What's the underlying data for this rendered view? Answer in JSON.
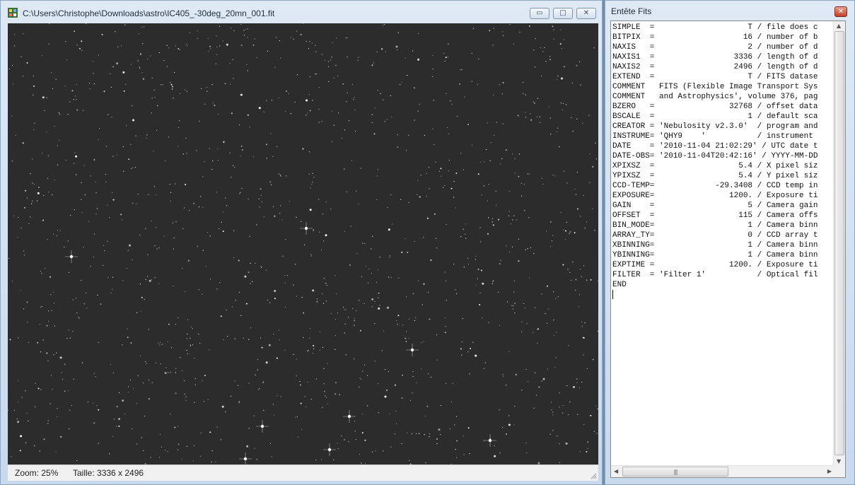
{
  "image_window": {
    "title": "C:\\Users\\Christophe\\Downloads\\astro\\IC405_-30deg_20mn_001.fit",
    "app_icon": "fits-viewer-icon",
    "buttons": {
      "minimize": "▭",
      "maximize": "□",
      "close": "✕"
    },
    "status": {
      "zoom": "Zoom: 25%",
      "size": "Taille: 3336 x 2496"
    }
  },
  "header_window": {
    "title": "Entête Fits",
    "close": "✕",
    "lines": [
      "SIMPLE  =                    T / file does c",
      "BITPIX  =                   16 / number of b",
      "NAXIS   =                    2 / number of d",
      "NAXIS1  =                 3336 / length of d",
      "NAXIS2  =                 2496 / length of d",
      "EXTEND  =                    T / FITS datase",
      "COMMENT   FITS (Flexible Image Transport Sys",
      "COMMENT   and Astrophysics', volume 376, pag",
      "BZERO   =                32768 / offset data",
      "BSCALE  =                    1 / default sca",
      "CREATOR = 'Nebulosity v2.3.0'  / program and",
      "INSTRUME= 'QHY9    '           / instrument",
      "DATE    = '2010-11-04 21:02:29' / UTC date t",
      "DATE-OBS= '2010-11-04T20:42:16' / YYYY-MM-DD",
      "XPIXSZ  =                  5.4 / X pixel siz",
      "YPIXSZ  =                  5.4 / Y pixel siz",
      "CCD-TEMP=             -29.3408 / CCD temp in",
      "EXPOSURE=                1200. / Exposure ti",
      "GAIN    =                    5 / Camera gain",
      "OFFSET  =                  115 / Camera offs",
      "BIN_MODE=                    1 / Camera binn",
      "ARRAY_TY=                    0 / CCD array t",
      "XBINNING=                    1 / Camera binn",
      "YBINNING=                    1 / Camera binn",
      "EXPTIME =                1200. / Exposure ti",
      "FILTER  = 'Filter 1'           / Optical fil",
      "END"
    ],
    "hscroll_grip": "|||"
  }
}
